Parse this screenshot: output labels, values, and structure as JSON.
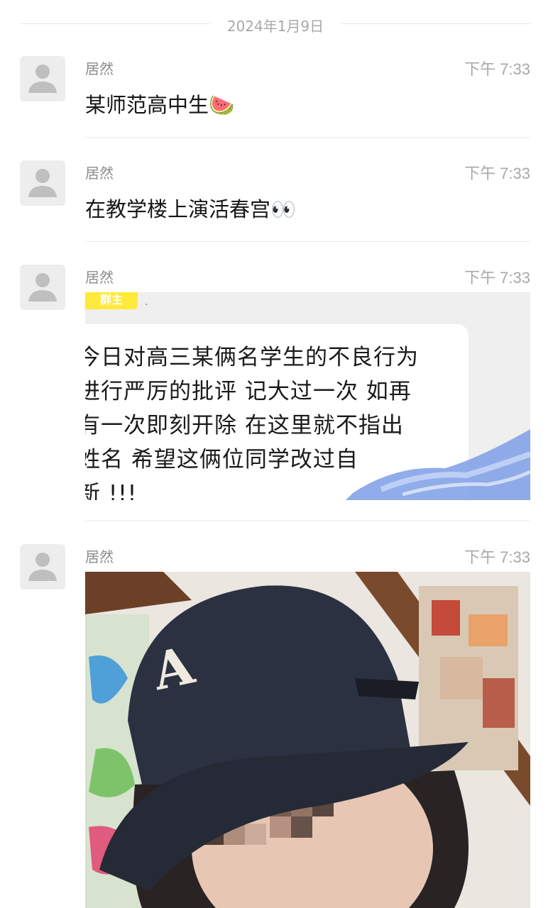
{
  "date_separator": "2024年1月9日",
  "messages": [
    {
      "sender": "居然",
      "time": "下午 7:33",
      "text": "某师范高中生🍉"
    },
    {
      "sender": "居然",
      "time": "下午 7:33",
      "text": "在教学楼上演活春宫👀"
    },
    {
      "sender": "居然",
      "time": "下午 7:33",
      "image": {
        "badge": "群主",
        "dot": ".",
        "text": "今日对高三某俩名学生的不良行为\n进行严厉的批评 记大过一次 如再\n有一次即刻开除 在这里就不指出\n姓名 希望这俩位同学改过自\n新 !!!"
      }
    },
    {
      "sender": "居然",
      "time": "下午 7:33",
      "photo": {
        "cap_letter": "A"
      }
    }
  ],
  "colors": {
    "background": "#ffffff",
    "name": "#8d8d8d",
    "time": "#a8a8a8",
    "avatar_bg": "#ededed",
    "badge": "#ffe93a"
  },
  "icons": [
    "default-avatar-icon",
    "watermelon-emoji",
    "eyes-emoji"
  ]
}
